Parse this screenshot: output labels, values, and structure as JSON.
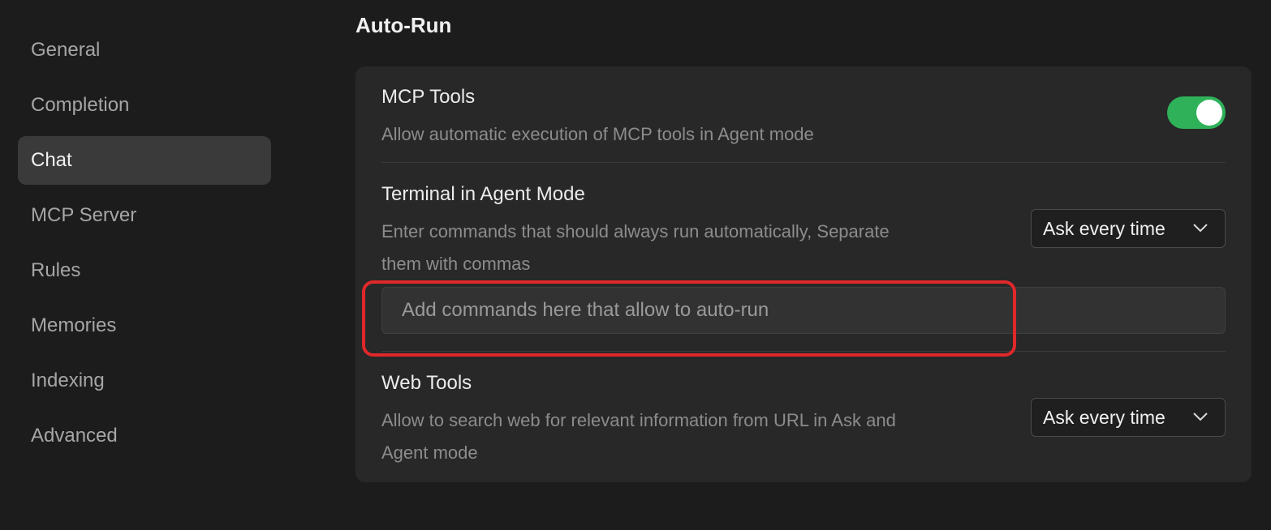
{
  "sidebar": {
    "items": [
      {
        "label": "General"
      },
      {
        "label": "Completion"
      },
      {
        "label": "Chat",
        "active": true
      },
      {
        "label": "MCP Server"
      },
      {
        "label": "Rules"
      },
      {
        "label": "Memories"
      },
      {
        "label": "Indexing"
      },
      {
        "label": "Advanced"
      }
    ]
  },
  "section": {
    "title": "Auto-Run"
  },
  "mcp_tools": {
    "title": "MCP Tools",
    "description": "Allow automatic execution of MCP tools in Agent mode",
    "enabled": true
  },
  "terminal": {
    "title": "Terminal in Agent Mode",
    "description_line1": "Enter commands that should always run automatically, Separate",
    "description_line2": "them with commas",
    "select_value": "Ask every time",
    "input_value": "",
    "input_placeholder": "Add commands here that allow to auto-run"
  },
  "web_tools": {
    "title": "Web Tools",
    "description_line1": "Allow to search web for relevant information from URL in Ask and",
    "description_line2": "Agent mode",
    "select_value": "Ask every time"
  },
  "colors": {
    "toggle_on": "#2fb15a",
    "highlight": "#e0282a",
    "active_nav": "#3a3a3a"
  }
}
